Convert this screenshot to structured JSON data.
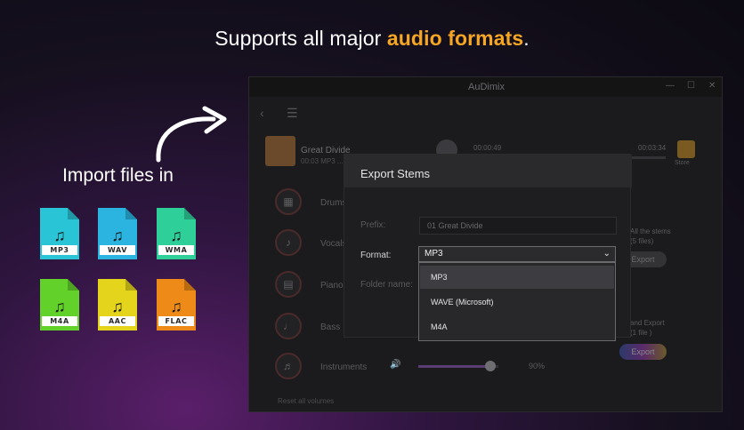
{
  "headline": {
    "prefix": "Supports all major ",
    "highlight": "audio formats",
    "suffix": "."
  },
  "import_label": "Import files in",
  "formats": [
    {
      "label": "MP3",
      "color": "#29c5d6"
    },
    {
      "label": "WAV",
      "color": "#2ab4df"
    },
    {
      "label": "WMA",
      "color": "#2fcf9a"
    },
    {
      "label": "M4A",
      "color": "#62d22a"
    },
    {
      "label": "AAC",
      "color": "#e4d51c"
    },
    {
      "label": "FLAC",
      "color": "#ee8a17"
    }
  ],
  "app": {
    "title": "AuDimix",
    "track": {
      "name": "Great Divide",
      "sub": "00:03 MP3 ..."
    },
    "time_start": "00:00:49",
    "time_end": "00:03:34",
    "store_label": "Store",
    "stems": [
      "Drums",
      "Vocals",
      "Piano",
      "Bass",
      "Instruments"
    ],
    "volume_percent": "90%",
    "volume_level": 0.9,
    "reset_label": "Reset all volumes",
    "side": {
      "export_stems_text": "All the stems",
      "export_stems_count": "(5 files)",
      "export_button": "Export",
      "mix_text": "and Export",
      "mix_count": "(1 file )",
      "mix_button": "Export"
    }
  },
  "dialog": {
    "title": "Export Stems",
    "prefix_label": "Prefix:",
    "prefix_value": "01 Great Divide",
    "format_label": "Format:",
    "format_value": "MP3",
    "folder_label": "Folder name:",
    "options": [
      "MP3",
      "WAVE (Microsoft)",
      "M4A"
    ],
    "selected_index": 0
  }
}
